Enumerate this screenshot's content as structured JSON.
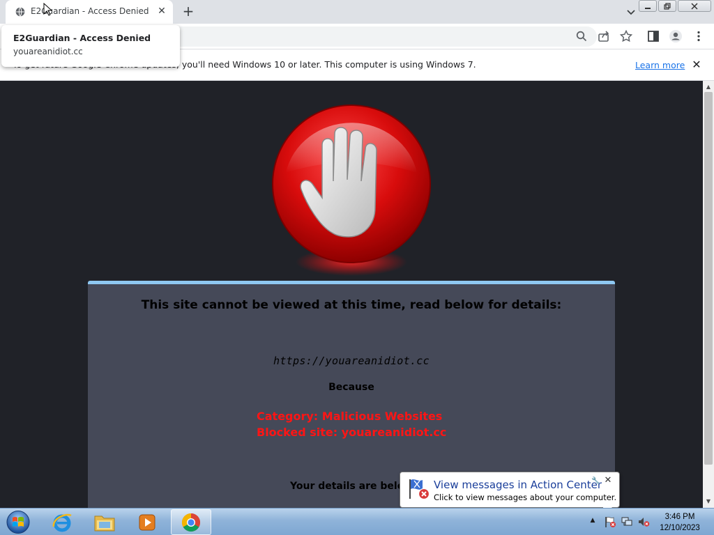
{
  "browser": {
    "tab": {
      "title": "E2Guardian - Access Denied"
    },
    "new_tab_label": "+",
    "hover_card": {
      "title": "E2Guardian - Access Denied",
      "domain": "youareanidiot.cc"
    },
    "infobar": {
      "message": "To get future Google Chrome updates, you'll need Windows 10 or later. This computer is using Windows 7.",
      "link": "Learn more"
    }
  },
  "page": {
    "heading": "This site cannot be viewed at this time, read below for details:",
    "blocked_url": "https://youareanidiot.cc",
    "because_label": "Because",
    "category_line": "Category: Malicious Websites",
    "blocked_line": "Blocked site: youareanidiot.cc",
    "details_label": "Your details are below:"
  },
  "notification": {
    "title": "View messages in Action Center",
    "subtitle": "Click to view messages about your computer."
  },
  "taskbar": {
    "time": "3:46 PM",
    "date": "12/10/2023"
  },
  "colors": {
    "page_bg": "#202228",
    "panel_bg": "#454958",
    "panel_accent": "#8ec8f2",
    "reason_red": "#ff1515",
    "link_blue": "#1a73e8"
  },
  "icons": {
    "tab_favicon": "globe-icon",
    "stop": "stop-hand-icon",
    "notification": "action-center-flag-icon"
  }
}
